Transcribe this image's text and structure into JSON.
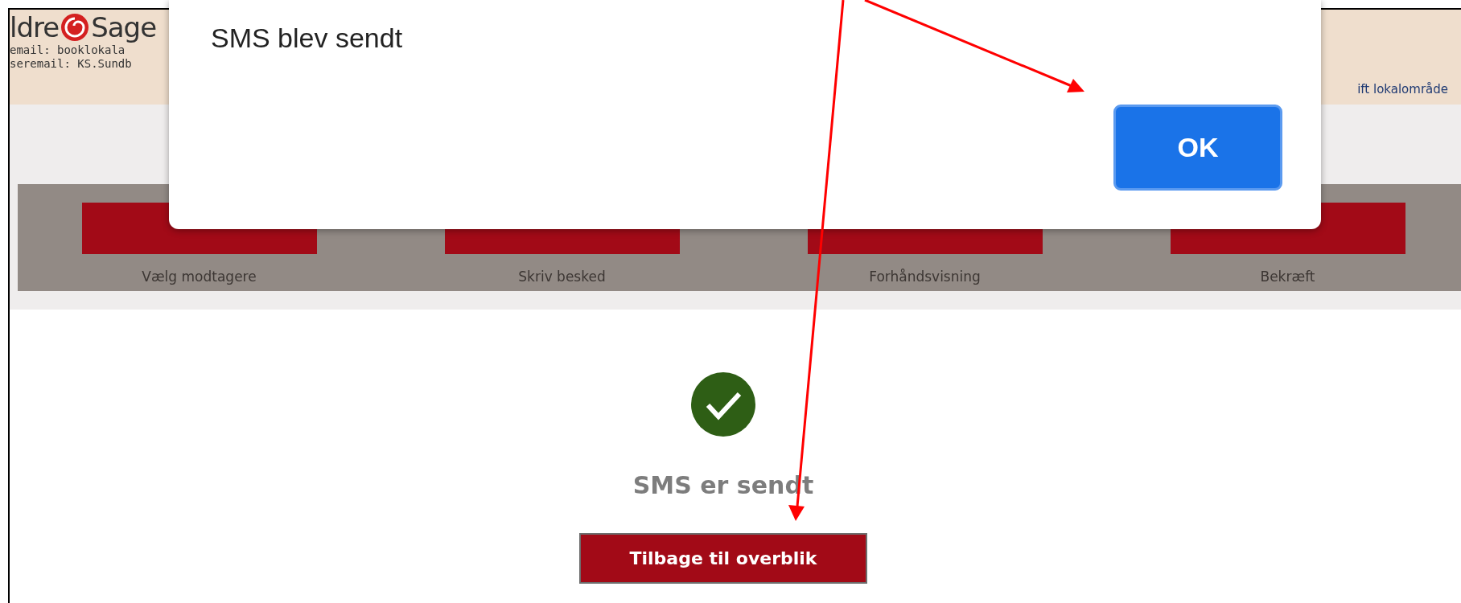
{
  "header": {
    "logo_left": "ldre",
    "logo_right": "Sage",
    "contact_lines": [
      "email: booklokala",
      "seremail: KS.Sundb"
    ],
    "link": "ift lokalområde"
  },
  "dialog": {
    "title": "SMS blev sendt",
    "button": "OK"
  },
  "steps": [
    {
      "label": "Vælg modtagere"
    },
    {
      "label": "Skriv besked"
    },
    {
      "label": "Forhåndsvisning"
    },
    {
      "label": "Bekræft"
    }
  ],
  "status": "SMS er sendt",
  "back_button": "Tilbage til overblik"
}
